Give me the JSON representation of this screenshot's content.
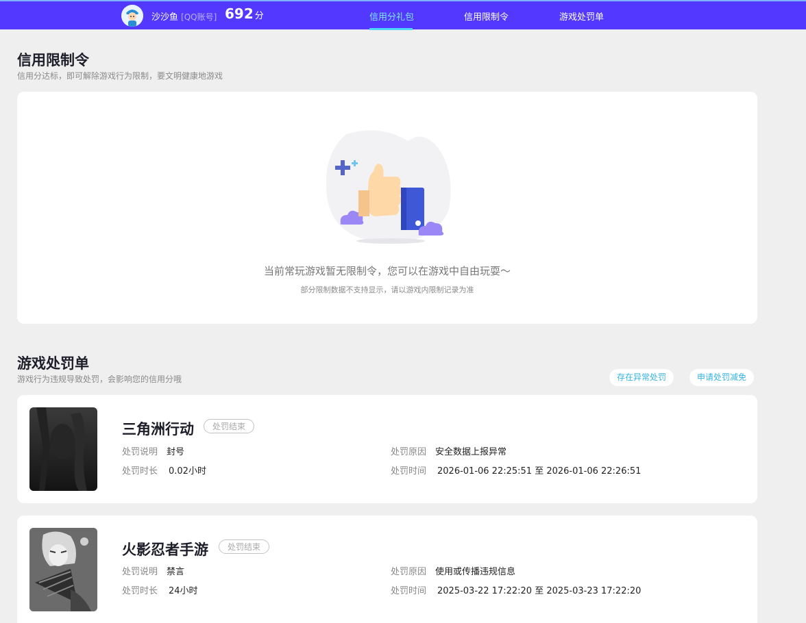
{
  "header": {
    "username": "沙沙鱼",
    "account_type": "[QQ账号]",
    "score": "692",
    "score_unit": "分",
    "nav": [
      "信用分礼包",
      "信用限制令",
      "游戏处罚单"
    ]
  },
  "restrictions": {
    "title": "信用限制令",
    "subtitle": "信用分达标，即可解除游戏行为限制，要文明健康地游戏",
    "empty_message": "当前常玩游戏暂无限制令，您可以在游戏中自由玩耍～",
    "empty_note": "部分限制数据不支持显示，请以游戏内限制记录为准"
  },
  "penalties": {
    "title": "游戏处罚单",
    "subtitle": "游戏行为违规导致处罚，会影响您的信用分哦",
    "buttons": [
      "存在异常处罚",
      "申请处罚减免"
    ],
    "items": [
      {
        "game": "三角洲行动",
        "status": "处罚结束",
        "desc_label": "处罚说明",
        "desc_value": "封号",
        "duration_label": "处罚时长",
        "duration_value": "0.02小时",
        "reason_label": "处罚原因",
        "reason_value": "安全数据上报异常",
        "time_label": "处罚时间",
        "time_value": "2026-01-06 22:25:51 至 2026-01-06 22:26:51"
      },
      {
        "game": "火影忍者手游",
        "status": "处罚结束",
        "desc_label": "处罚说明",
        "desc_value": "禁言",
        "duration_label": "处罚时长",
        "duration_value": "24小时",
        "reason_label": "处罚原因",
        "reason_value": "使用或传播违规信息",
        "time_label": "处罚时间",
        "time_value": "2025-03-22 17:22:20 至 2025-03-23 17:22:20"
      }
    ]
  },
  "colors": {
    "header_bg": "#5338ff",
    "active_nav": "#7fe7ff",
    "link": "#35b4e0"
  }
}
